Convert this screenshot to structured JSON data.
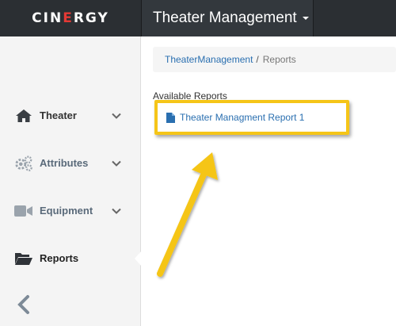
{
  "header": {
    "logo": "CINERGY",
    "app_title": "Theater Management"
  },
  "sidebar": {
    "items": [
      {
        "label": "Theater",
        "icon": "home-icon",
        "has_submenu": true
      },
      {
        "label": "Attributes",
        "icon": "gears-icon",
        "has_submenu": true
      },
      {
        "label": "Equipment",
        "icon": "video-camera-icon",
        "has_submenu": true
      },
      {
        "label": "Reports",
        "icon": "folder-open-icon",
        "has_submenu": false,
        "active": true
      }
    ],
    "collapse_icon": "chevron-left-icon"
  },
  "breadcrumb": {
    "link": "TheaterManagement",
    "separator": "/",
    "current": "Reports"
  },
  "main": {
    "section_title": "Available Reports",
    "reports": [
      {
        "label": "Theater Managment Report 1",
        "icon": "file-icon"
      }
    ]
  },
  "annotation": {
    "highlight_color": "#f5c518"
  },
  "colors": {
    "topbar": "#2b2f33",
    "link": "#2a6fb0",
    "logo_accent": "#e53935"
  }
}
